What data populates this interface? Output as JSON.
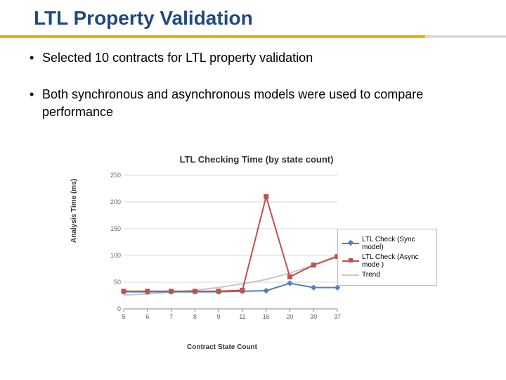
{
  "header": {
    "title": "LTL Property Validation"
  },
  "bullets": [
    "Selected 10 contracts for LTL property validation",
    "Both synchronous and asynchronous models were used to compare performance"
  ],
  "chart_data": {
    "type": "line",
    "title": "LTL Checking Time (by state count)",
    "xlabel": "Contract State Count",
    "ylabel": "Analysis Time (ms)",
    "ylim": [
      0,
      250
    ],
    "yticks": [
      0,
      50,
      100,
      150,
      200,
      250
    ],
    "categories": [
      "5",
      "6",
      "7",
      "8",
      "9",
      "11",
      "16",
      "20",
      "30",
      "37"
    ],
    "series": [
      {
        "name": "LTL Check (Sync model)",
        "color": "#4f81bd",
        "marker": "diamond",
        "values": [
          32,
          32,
          32,
          32,
          32,
          33,
          34,
          48,
          40,
          40
        ]
      },
      {
        "name": "LTL Check (Async mode )",
        "color": "#c0504d",
        "marker": "square",
        "values": [
          33,
          33,
          33,
          33,
          33,
          35,
          210,
          60,
          82,
          98
        ]
      },
      {
        "name": "Trend",
        "color": "#c7c7c7",
        "marker": "none",
        "values": [
          26,
          28,
          31,
          35,
          40,
          47,
          55,
          67,
          82,
          100
        ]
      }
    ],
    "legend_position": "right"
  }
}
